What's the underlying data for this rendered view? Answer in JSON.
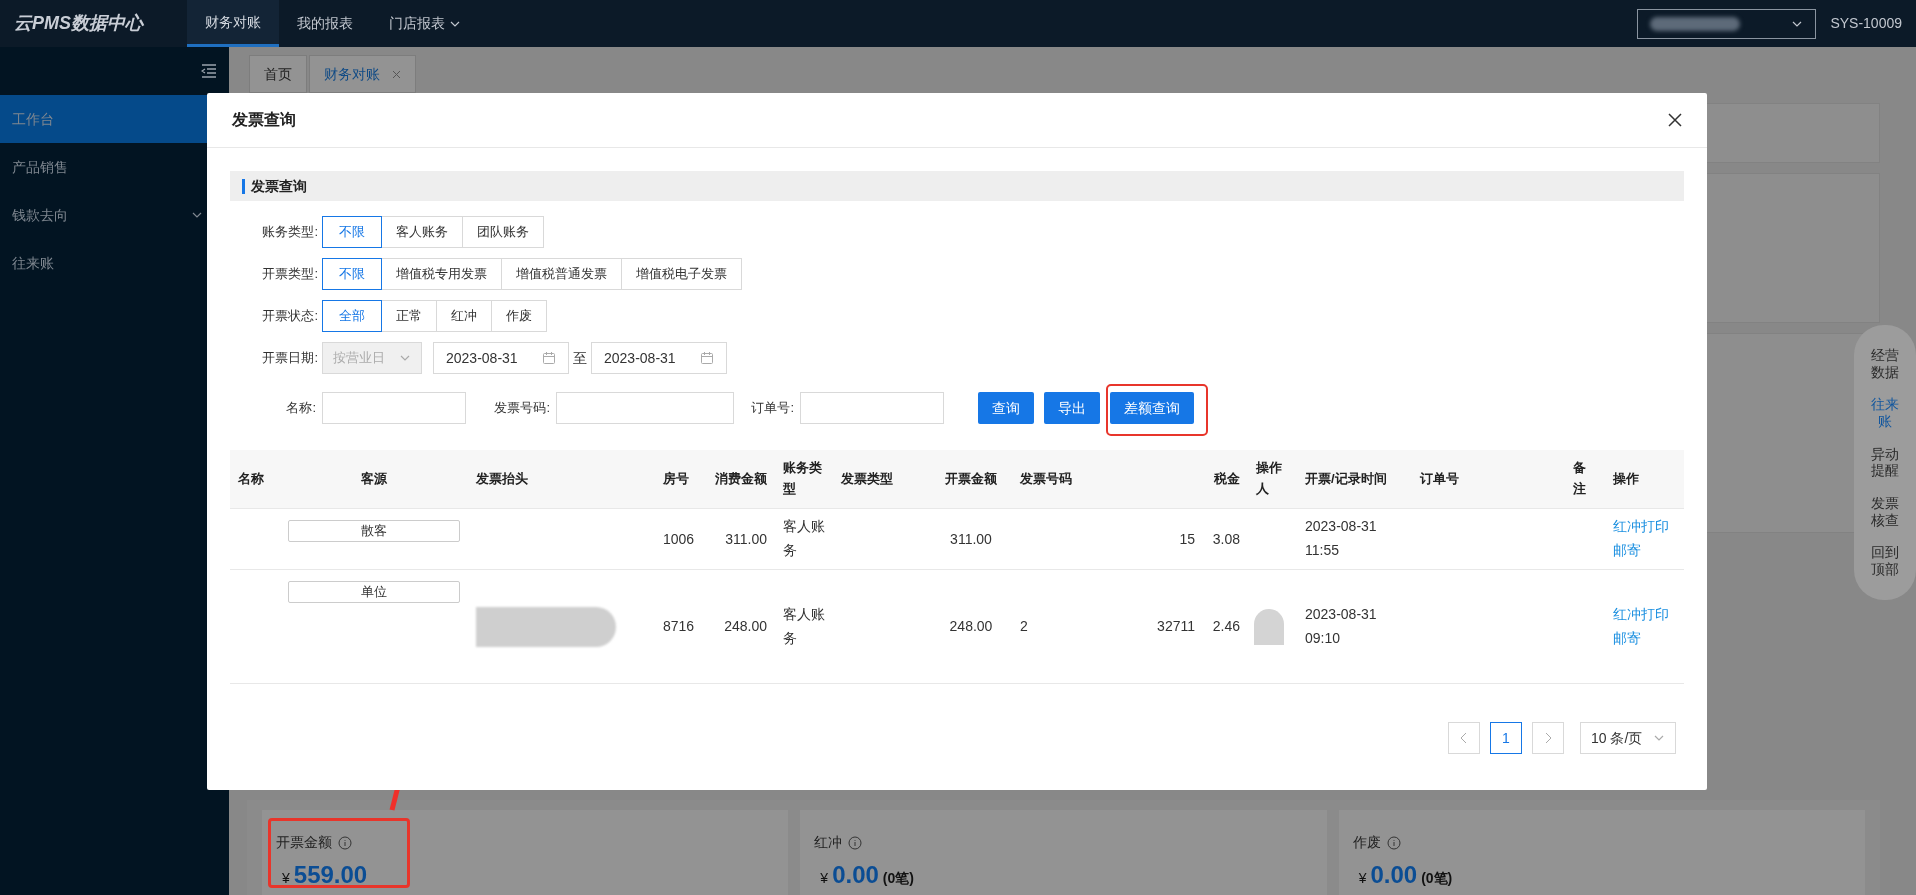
{
  "header": {
    "logo": "云PMS数据中心",
    "nav": [
      {
        "label": "财务对账",
        "selected": true,
        "dropdown": false
      },
      {
        "label": "我的报表",
        "selected": false,
        "dropdown": false
      },
      {
        "label": "门店报表",
        "selected": false,
        "dropdown": true
      }
    ],
    "system_id": "SYS-10009"
  },
  "sidebar": {
    "items": [
      {
        "label": "工作台",
        "selected": true,
        "expandable": false
      },
      {
        "label": "产品销售",
        "selected": false,
        "expandable": false
      },
      {
        "label": "钱款去向",
        "selected": false,
        "expandable": true
      },
      {
        "label": "往来账",
        "selected": false,
        "expandable": false
      }
    ]
  },
  "page_tabs": [
    {
      "label": "首页",
      "selected": false,
      "closable": false
    },
    {
      "label": "财务对账",
      "selected": true,
      "closable": true
    }
  ],
  "modal": {
    "title": "发票查询",
    "section_title": "发票查询",
    "filters": [
      {
        "label": "账务类型:",
        "options": [
          {
            "label": "不限",
            "selected": true
          },
          {
            "label": "客人账务",
            "selected": false
          },
          {
            "label": "团队账务",
            "selected": false
          }
        ]
      },
      {
        "label": "开票类型:",
        "options": [
          {
            "label": "不限",
            "selected": true
          },
          {
            "label": "增值税专用发票",
            "selected": false
          },
          {
            "label": "增值税普通发票",
            "selected": false
          },
          {
            "label": "增值税电子发票",
            "selected": false
          }
        ]
      },
      {
        "label": "开票状态:",
        "options": [
          {
            "label": "全部",
            "selected": true
          },
          {
            "label": "正常",
            "selected": false
          },
          {
            "label": "红冲",
            "selected": false
          },
          {
            "label": "作废",
            "selected": false
          }
        ]
      }
    ],
    "date_filter": {
      "label": "开票日期:",
      "mode": "按营业日",
      "mode_disabled": true,
      "from": "2023-08-31",
      "separator": "至",
      "to": "2023-08-31"
    },
    "search_fields": [
      {
        "label": "名称:"
      },
      {
        "label": "发票号码:"
      },
      {
        "label": "订单号:"
      }
    ],
    "buttons": [
      {
        "label": "查询",
        "highlighted": false
      },
      {
        "label": "导出",
        "highlighted": false
      },
      {
        "label": "差额查询",
        "highlighted": true
      }
    ],
    "table": {
      "columns": [
        "名称",
        "客源",
        "发票抬头",
        "房号",
        "消费金额",
        "账务类型",
        "发票类型",
        "开票金额",
        "发票号码",
        "税金",
        "操作人",
        "开票/记录时间",
        "订单号",
        "备注",
        "操作"
      ],
      "rows": [
        {
          "source": "散客",
          "room": "1006",
          "consumption": "311.00",
          "account_type": "客人账务",
          "invoice_amount": "311.00",
          "invoice_no": [
            "15"
          ],
          "tax": "3.08",
          "time": "2023-08-31 11:55",
          "actions": [
            "红冲打印",
            "邮寄"
          ]
        },
        {
          "source": "单位",
          "room": "8716",
          "consumption": "248.00",
          "account_type": "客人账务",
          "invoice_amount": "248.00",
          "invoice_no": [
            "2",
            "32711"
          ],
          "tax": "2.46",
          "time": "2023-08-31 09:10",
          "actions": [
            "红冲打印",
            "邮寄"
          ]
        }
      ]
    },
    "pagination": {
      "pages": [
        {
          "label": "1",
          "selected": true
        }
      ],
      "page_size": "10 条/页"
    }
  },
  "float_menu": [
    {
      "label": "经营数据",
      "selected": false
    },
    {
      "label": "往来账",
      "selected": true
    },
    {
      "label": "异动提醒",
      "selected": false
    },
    {
      "label": "发票核查",
      "selected": false
    },
    {
      "label": "回到顶部",
      "selected": false
    }
  ],
  "summary_cards": [
    {
      "label": "开票金额",
      "currency": "¥",
      "amount": "559.00",
      "highlighted": true
    },
    {
      "label": "红冲",
      "currency": "¥",
      "amount": "0.00",
      "count": "(0笔)",
      "highlighted": false
    },
    {
      "label": "作废",
      "currency": "¥",
      "amount": "0.00",
      "count": "(0笔)",
      "highlighted": false
    }
  ]
}
